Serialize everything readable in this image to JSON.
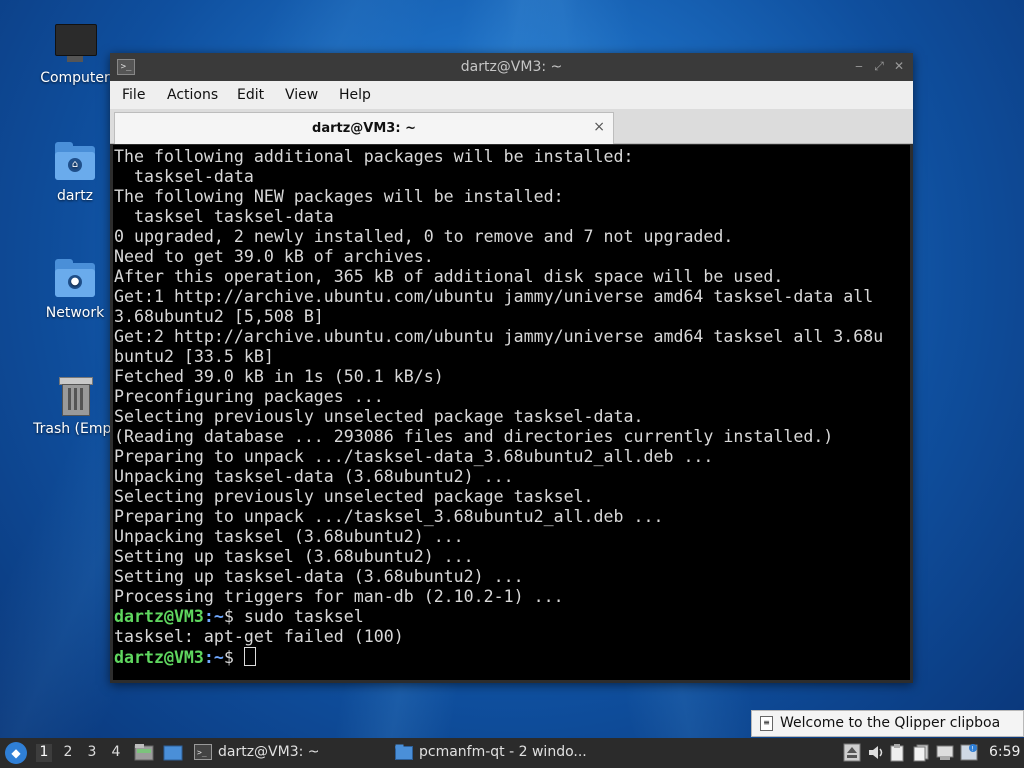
{
  "desktop": {
    "icons": [
      {
        "label": "Computer",
        "icon": "computer-icon"
      },
      {
        "label": "dartz",
        "icon": "home-folder-icon"
      },
      {
        "label": "Network",
        "icon": "network-folder-icon"
      },
      {
        "label": "Trash (Empt",
        "icon": "trash-icon"
      }
    ]
  },
  "window": {
    "title": "dartz@VM3: ~",
    "menu": [
      "File",
      "Actions",
      "Edit",
      "View",
      "Help"
    ],
    "tab": {
      "label": "dartz@VM3: ~",
      "close": "×"
    }
  },
  "terminal": {
    "lines": [
      "The following additional packages will be installed:",
      "  tasksel-data",
      "The following NEW packages will be installed:",
      "  tasksel tasksel-data",
      "0 upgraded, 2 newly installed, 0 to remove and 7 not upgraded.",
      "Need to get 39.0 kB of archives.",
      "After this operation, 365 kB of additional disk space will be used.",
      "Get:1 http://archive.ubuntu.com/ubuntu jammy/universe amd64 tasksel-data all",
      "3.68ubuntu2 [5,508 B]",
      "Get:2 http://archive.ubuntu.com/ubuntu jammy/universe amd64 tasksel all 3.68u",
      "buntu2 [33.5 kB]",
      "Fetched 39.0 kB in 1s (50.1 kB/s)",
      "Preconfiguring packages ...",
      "Selecting previously unselected package tasksel-data.",
      "(Reading database ... 293086 files and directories currently installed.)",
      "Preparing to unpack .../tasksel-data_3.68ubuntu2_all.deb ...",
      "Unpacking tasksel-data (3.68ubuntu2) ...",
      "Selecting previously unselected package tasksel.",
      "Preparing to unpack .../tasksel_3.68ubuntu2_all.deb ...",
      "Unpacking tasksel (3.68ubuntu2) ...",
      "Setting up tasksel (3.68ubuntu2) ...",
      "Setting up tasksel-data (3.68ubuntu2) ...",
      "Processing triggers for man-db (2.10.2-1) ..."
    ],
    "prompt_user": "dartz@VM3",
    "prompt_path": ":~",
    "prompt_symbol": "$",
    "command": " sudo tasksel",
    "error_line": "tasksel: apt-get failed (100)"
  },
  "notification": {
    "text": "Welcome to the Qlipper clipboa"
  },
  "taskbar": {
    "workspaces": [
      "1",
      "2",
      "3",
      "4"
    ],
    "active_workspace": "1",
    "tasks": [
      {
        "label": "dartz@VM3: ~",
        "icon": "terminal-icon"
      },
      {
        "label": "pcmanfm-qt - 2 windo...",
        "icon": "folder-icon"
      }
    ],
    "clock": "6:59"
  },
  "colors": {
    "prompt_user": "#5fd75f",
    "prompt_path": "#6fa8ff",
    "terminal_bg": "#000000",
    "taskbar_bg": "#2b2b2b"
  }
}
